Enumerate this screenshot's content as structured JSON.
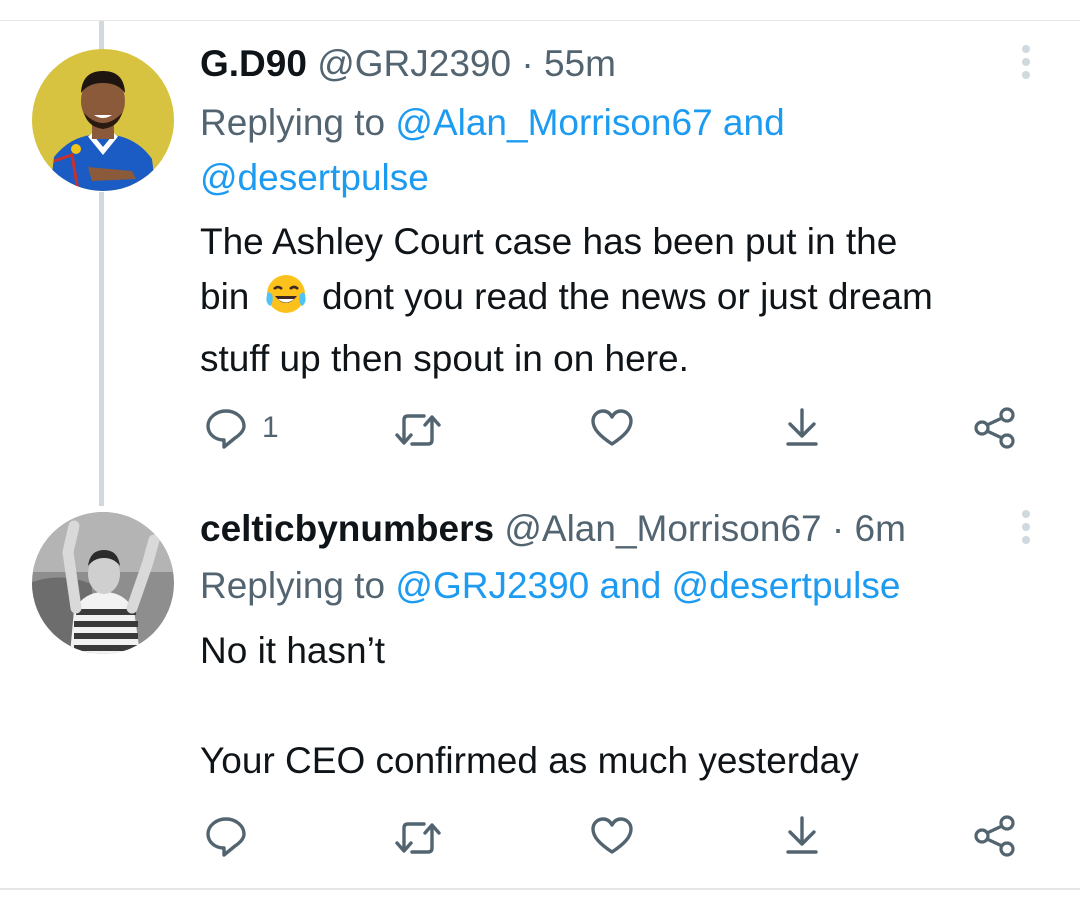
{
  "tweets": [
    {
      "display_name": "G.D90",
      "handle": "@GRJ2390",
      "separator": "·",
      "time": "55m",
      "replying_prefix": "Replying to",
      "replying_line1": "@Alan_Morrison67 and",
      "replying_line2": "@desertpulse",
      "text_line1": "The Ashley Court case has been put in the",
      "text_line2_a": "bin",
      "emoji": "face-with-tears-of-joy",
      "text_line2_b": "dont you read the news or just dream",
      "text_line3": "stuff up then spout in on here.",
      "reply_count": "1",
      "icons": [
        "reply-icon",
        "retweet-icon",
        "like-icon",
        "download-icon",
        "share-icon",
        "more-icon"
      ]
    },
    {
      "display_name": "celticbynumbers",
      "handle": "@Alan_Morrison67",
      "separator": "·",
      "time": "6m",
      "replying_prefix": "Replying to",
      "replying_line1": "@GRJ2390 and @desertpulse",
      "text_line1": "No it hasn’t",
      "text_line2": "Your CEO confirmed as much yesterday",
      "icons": [
        "reply-icon",
        "retweet-icon",
        "like-icon",
        "download-icon",
        "share-icon",
        "more-icon"
      ]
    }
  ],
  "colors": {
    "text": "#0f1419",
    "muted": "#536471",
    "link": "#1d9bf0",
    "thread_line": "#cfd9de",
    "avatar1_background": "#d8c341",
    "avatar1_jersey": "#1a5bc4"
  }
}
